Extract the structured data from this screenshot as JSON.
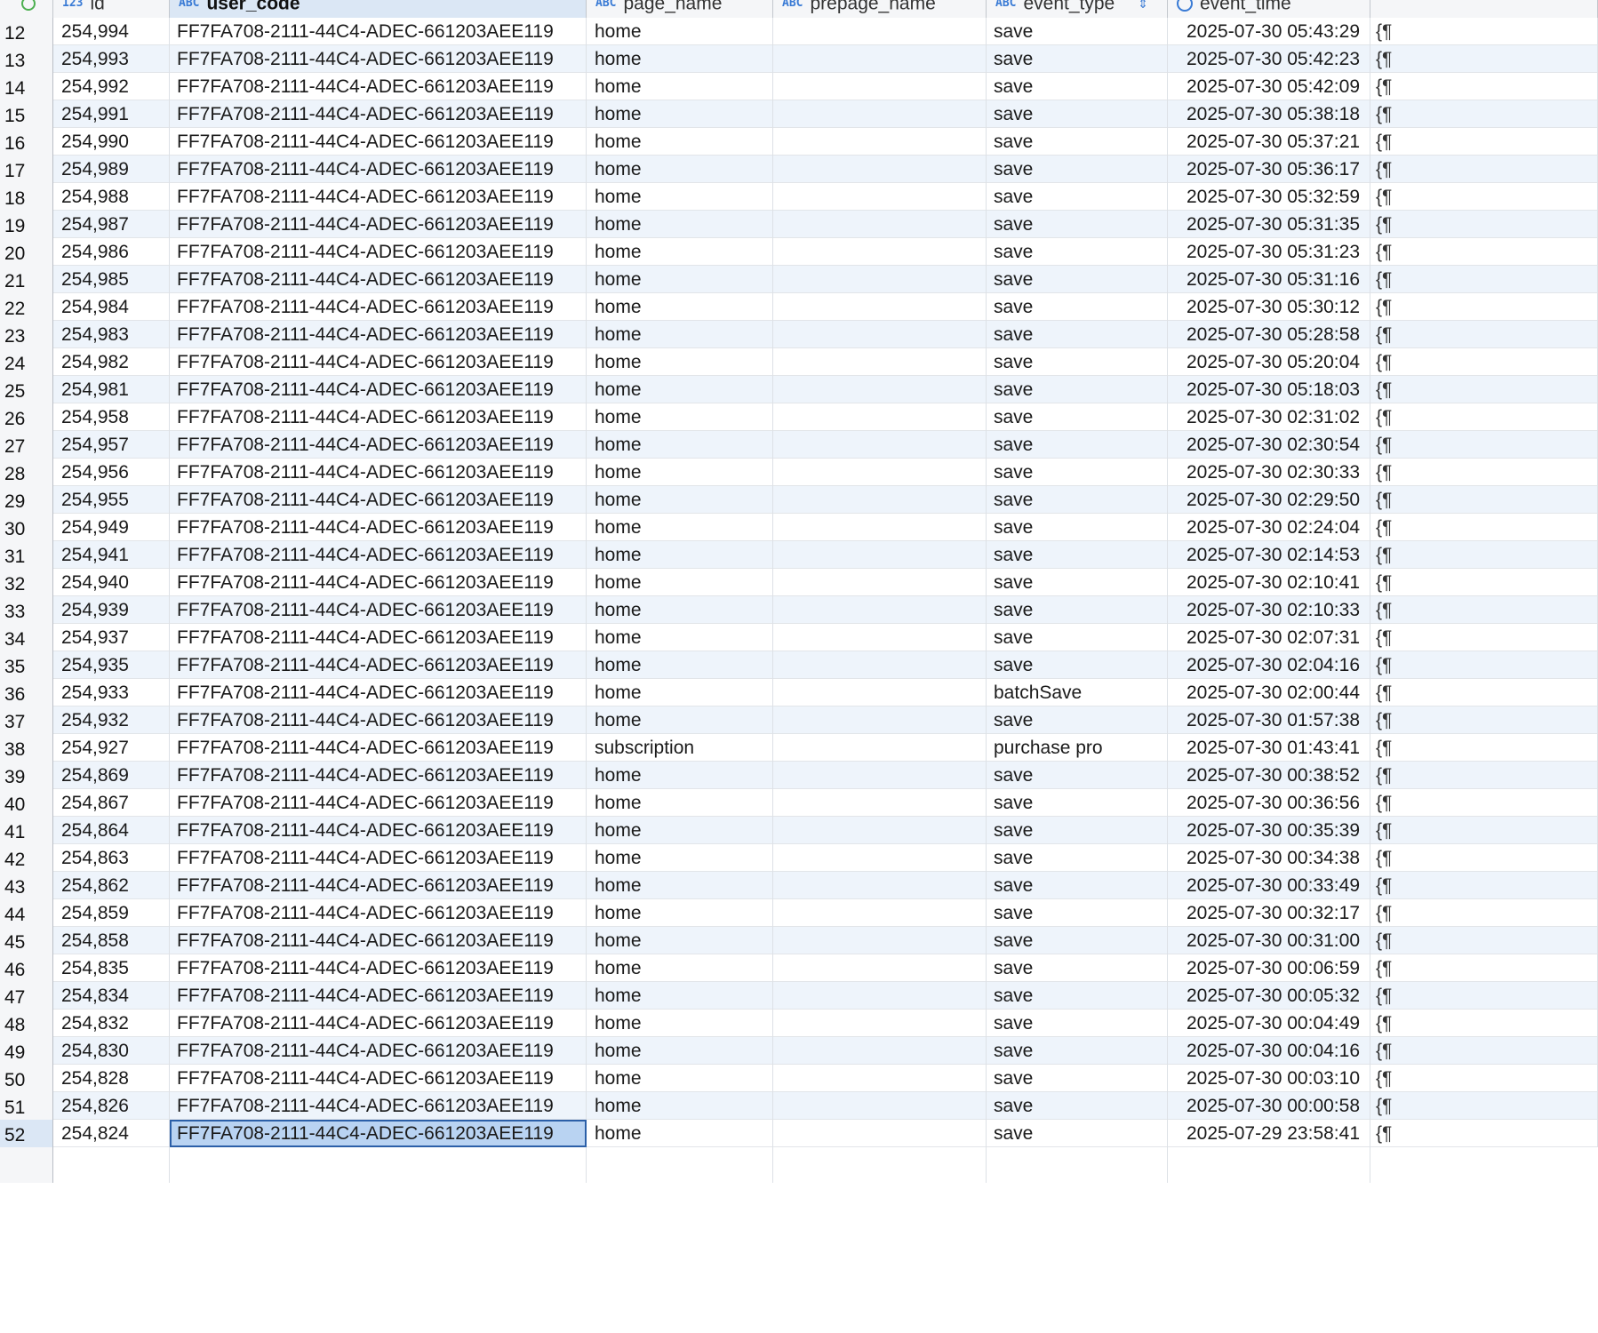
{
  "grid": {
    "columns": [
      {
        "key": "rownum",
        "label": ""
      },
      {
        "key": "id",
        "label": "id",
        "type_icon": "123"
      },
      {
        "key": "user_code",
        "label": "user_code",
        "type_icon": "ABC"
      },
      {
        "key": "page_name",
        "label": "page_name",
        "type_icon": "ABC"
      },
      {
        "key": "prepage_name",
        "label": "prepage_name",
        "type_icon": "ABC"
      },
      {
        "key": "event_type",
        "label": "event_type",
        "type_icon": "ABC"
      },
      {
        "key": "event_time",
        "label": "event_time",
        "type_icon": "clock-icon"
      }
    ],
    "extra_cell_glyph": "{¶",
    "selected_column": "user_code",
    "current_row": 52,
    "rows": [
      {
        "n": "12",
        "id": "254,994",
        "user_code": "FF7FA708-2111-44C4-ADEC-661203AEE119",
        "page_name": "home",
        "prepage_name": "",
        "event_type": "save",
        "event_time": "2025-07-30 05:43:29"
      },
      {
        "n": "13",
        "id": "254,993",
        "user_code": "FF7FA708-2111-44C4-ADEC-661203AEE119",
        "page_name": "home",
        "prepage_name": "",
        "event_type": "save",
        "event_time": "2025-07-30 05:42:23"
      },
      {
        "n": "14",
        "id": "254,992",
        "user_code": "FF7FA708-2111-44C4-ADEC-661203AEE119",
        "page_name": "home",
        "prepage_name": "",
        "event_type": "save",
        "event_time": "2025-07-30 05:42:09"
      },
      {
        "n": "15",
        "id": "254,991",
        "user_code": "FF7FA708-2111-44C4-ADEC-661203AEE119",
        "page_name": "home",
        "prepage_name": "",
        "event_type": "save",
        "event_time": "2025-07-30 05:38:18"
      },
      {
        "n": "16",
        "id": "254,990",
        "user_code": "FF7FA708-2111-44C4-ADEC-661203AEE119",
        "page_name": "home",
        "prepage_name": "",
        "event_type": "save",
        "event_time": "2025-07-30 05:37:21"
      },
      {
        "n": "17",
        "id": "254,989",
        "user_code": "FF7FA708-2111-44C4-ADEC-661203AEE119",
        "page_name": "home",
        "prepage_name": "",
        "event_type": "save",
        "event_time": "2025-07-30 05:36:17"
      },
      {
        "n": "18",
        "id": "254,988",
        "user_code": "FF7FA708-2111-44C4-ADEC-661203AEE119",
        "page_name": "home",
        "prepage_name": "",
        "event_type": "save",
        "event_time": "2025-07-30 05:32:59"
      },
      {
        "n": "19",
        "id": "254,987",
        "user_code": "FF7FA708-2111-44C4-ADEC-661203AEE119",
        "page_name": "home",
        "prepage_name": "",
        "event_type": "save",
        "event_time": "2025-07-30 05:31:35"
      },
      {
        "n": "20",
        "id": "254,986",
        "user_code": "FF7FA708-2111-44C4-ADEC-661203AEE119",
        "page_name": "home",
        "prepage_name": "",
        "event_type": "save",
        "event_time": "2025-07-30 05:31:23"
      },
      {
        "n": "21",
        "id": "254,985",
        "user_code": "FF7FA708-2111-44C4-ADEC-661203AEE119",
        "page_name": "home",
        "prepage_name": "",
        "event_type": "save",
        "event_time": "2025-07-30 05:31:16"
      },
      {
        "n": "22",
        "id": "254,984",
        "user_code": "FF7FA708-2111-44C4-ADEC-661203AEE119",
        "page_name": "home",
        "prepage_name": "",
        "event_type": "save",
        "event_time": "2025-07-30 05:30:12"
      },
      {
        "n": "23",
        "id": "254,983",
        "user_code": "FF7FA708-2111-44C4-ADEC-661203AEE119",
        "page_name": "home",
        "prepage_name": "",
        "event_type": "save",
        "event_time": "2025-07-30 05:28:58"
      },
      {
        "n": "24",
        "id": "254,982",
        "user_code": "FF7FA708-2111-44C4-ADEC-661203AEE119",
        "page_name": "home",
        "prepage_name": "",
        "event_type": "save",
        "event_time": "2025-07-30 05:20:04"
      },
      {
        "n": "25",
        "id": "254,981",
        "user_code": "FF7FA708-2111-44C4-ADEC-661203AEE119",
        "page_name": "home",
        "prepage_name": "",
        "event_type": "save",
        "event_time": "2025-07-30 05:18:03"
      },
      {
        "n": "26",
        "id": "254,958",
        "user_code": "FF7FA708-2111-44C4-ADEC-661203AEE119",
        "page_name": "home",
        "prepage_name": "",
        "event_type": "save",
        "event_time": "2025-07-30 02:31:02"
      },
      {
        "n": "27",
        "id": "254,957",
        "user_code": "FF7FA708-2111-44C4-ADEC-661203AEE119",
        "page_name": "home",
        "prepage_name": "",
        "event_type": "save",
        "event_time": "2025-07-30 02:30:54"
      },
      {
        "n": "28",
        "id": "254,956",
        "user_code": "FF7FA708-2111-44C4-ADEC-661203AEE119",
        "page_name": "home",
        "prepage_name": "",
        "event_type": "save",
        "event_time": "2025-07-30 02:30:33"
      },
      {
        "n": "29",
        "id": "254,955",
        "user_code": "FF7FA708-2111-44C4-ADEC-661203AEE119",
        "page_name": "home",
        "prepage_name": "",
        "event_type": "save",
        "event_time": "2025-07-30 02:29:50"
      },
      {
        "n": "30",
        "id": "254,949",
        "user_code": "FF7FA708-2111-44C4-ADEC-661203AEE119",
        "page_name": "home",
        "prepage_name": "",
        "event_type": "save",
        "event_time": "2025-07-30 02:24:04"
      },
      {
        "n": "31",
        "id": "254,941",
        "user_code": "FF7FA708-2111-44C4-ADEC-661203AEE119",
        "page_name": "home",
        "prepage_name": "",
        "event_type": "save",
        "event_time": "2025-07-30 02:14:53"
      },
      {
        "n": "32",
        "id": "254,940",
        "user_code": "FF7FA708-2111-44C4-ADEC-661203AEE119",
        "page_name": "home",
        "prepage_name": "",
        "event_type": "save",
        "event_time": "2025-07-30 02:10:41"
      },
      {
        "n": "33",
        "id": "254,939",
        "user_code": "FF7FA708-2111-44C4-ADEC-661203AEE119",
        "page_name": "home",
        "prepage_name": "",
        "event_type": "save",
        "event_time": "2025-07-30 02:10:33"
      },
      {
        "n": "34",
        "id": "254,937",
        "user_code": "FF7FA708-2111-44C4-ADEC-661203AEE119",
        "page_name": "home",
        "prepage_name": "",
        "event_type": "save",
        "event_time": "2025-07-30 02:07:31"
      },
      {
        "n": "35",
        "id": "254,935",
        "user_code": "FF7FA708-2111-44C4-ADEC-661203AEE119",
        "page_name": "home",
        "prepage_name": "",
        "event_type": "save",
        "event_time": "2025-07-30 02:04:16"
      },
      {
        "n": "36",
        "id": "254,933",
        "user_code": "FF7FA708-2111-44C4-ADEC-661203AEE119",
        "page_name": "home",
        "prepage_name": "",
        "event_type": "batchSave",
        "event_time": "2025-07-30 02:00:44"
      },
      {
        "n": "37",
        "id": "254,932",
        "user_code": "FF7FA708-2111-44C4-ADEC-661203AEE119",
        "page_name": "home",
        "prepage_name": "",
        "event_type": "save",
        "event_time": "2025-07-30 01:57:38"
      },
      {
        "n": "38",
        "id": "254,927",
        "user_code": "FF7FA708-2111-44C4-ADEC-661203AEE119",
        "page_name": "subscription",
        "prepage_name": "",
        "event_type": "purchase pro",
        "event_time": "2025-07-30 01:43:41"
      },
      {
        "n": "39",
        "id": "254,869",
        "user_code": "FF7FA708-2111-44C4-ADEC-661203AEE119",
        "page_name": "home",
        "prepage_name": "",
        "event_type": "save",
        "event_time": "2025-07-30 00:38:52"
      },
      {
        "n": "40",
        "id": "254,867",
        "user_code": "FF7FA708-2111-44C4-ADEC-661203AEE119",
        "page_name": "home",
        "prepage_name": "",
        "event_type": "save",
        "event_time": "2025-07-30 00:36:56"
      },
      {
        "n": "41",
        "id": "254,864",
        "user_code": "FF7FA708-2111-44C4-ADEC-661203AEE119",
        "page_name": "home",
        "prepage_name": "",
        "event_type": "save",
        "event_time": "2025-07-30 00:35:39"
      },
      {
        "n": "42",
        "id": "254,863",
        "user_code": "FF7FA708-2111-44C4-ADEC-661203AEE119",
        "page_name": "home",
        "prepage_name": "",
        "event_type": "save",
        "event_time": "2025-07-30 00:34:38"
      },
      {
        "n": "43",
        "id": "254,862",
        "user_code": "FF7FA708-2111-44C4-ADEC-661203AEE119",
        "page_name": "home",
        "prepage_name": "",
        "event_type": "save",
        "event_time": "2025-07-30 00:33:49"
      },
      {
        "n": "44",
        "id": "254,859",
        "user_code": "FF7FA708-2111-44C4-ADEC-661203AEE119",
        "page_name": "home",
        "prepage_name": "",
        "event_type": "save",
        "event_time": "2025-07-30 00:32:17"
      },
      {
        "n": "45",
        "id": "254,858",
        "user_code": "FF7FA708-2111-44C4-ADEC-661203AEE119",
        "page_name": "home",
        "prepage_name": "",
        "event_type": "save",
        "event_time": "2025-07-30 00:31:00"
      },
      {
        "n": "46",
        "id": "254,835",
        "user_code": "FF7FA708-2111-44C4-ADEC-661203AEE119",
        "page_name": "home",
        "prepage_name": "",
        "event_type": "save",
        "event_time": "2025-07-30 00:06:59"
      },
      {
        "n": "47",
        "id": "254,834",
        "user_code": "FF7FA708-2111-44C4-ADEC-661203AEE119",
        "page_name": "home",
        "prepage_name": "",
        "event_type": "save",
        "event_time": "2025-07-30 00:05:32"
      },
      {
        "n": "48",
        "id": "254,832",
        "user_code": "FF7FA708-2111-44C4-ADEC-661203AEE119",
        "page_name": "home",
        "prepage_name": "",
        "event_type": "save",
        "event_time": "2025-07-30 00:04:49"
      },
      {
        "n": "49",
        "id": "254,830",
        "user_code": "FF7FA708-2111-44C4-ADEC-661203AEE119",
        "page_name": "home",
        "prepage_name": "",
        "event_type": "save",
        "event_time": "2025-07-30 00:04:16"
      },
      {
        "n": "50",
        "id": "254,828",
        "user_code": "FF7FA708-2111-44C4-ADEC-661203AEE119",
        "page_name": "home",
        "prepage_name": "",
        "event_type": "save",
        "event_time": "2025-07-30 00:03:10"
      },
      {
        "n": "51",
        "id": "254,826",
        "user_code": "FF7FA708-2111-44C4-ADEC-661203AEE119",
        "page_name": "home",
        "prepage_name": "",
        "event_type": "save",
        "event_time": "2025-07-30 00:00:58"
      },
      {
        "n": "52",
        "id": "254,824",
        "user_code": "FF7FA708-2111-44C4-ADEC-661203AEE119",
        "page_name": "home",
        "prepage_name": "",
        "event_type": "save",
        "event_time": "2025-07-29 23:58:41"
      }
    ]
  }
}
